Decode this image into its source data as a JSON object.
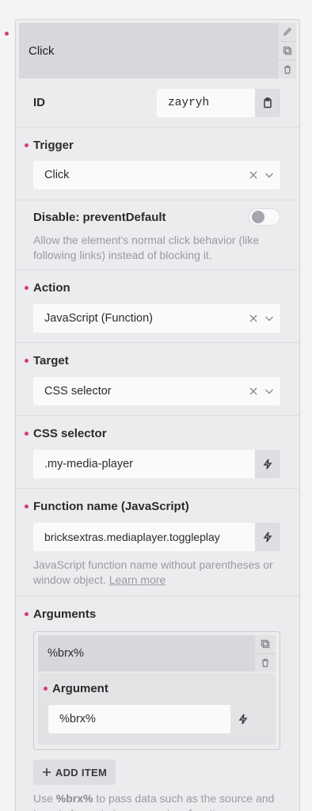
{
  "interaction": {
    "header_title": "Click",
    "header_actions": [
      "edit-icon",
      "copy-icon",
      "trash-icon"
    ]
  },
  "id_field": {
    "label": "ID",
    "value": "zayryh",
    "copy_icon": "clipboard-icon"
  },
  "trigger": {
    "label": "Trigger",
    "value": "Click"
  },
  "prevent_default": {
    "label": "Disable: preventDefault",
    "enabled": false,
    "description": "Allow the element's normal click behavior (like following links) instead of blocking it."
  },
  "action": {
    "label": "Action",
    "value": "JavaScript (Function)"
  },
  "target": {
    "label": "Target",
    "value": "CSS selector"
  },
  "css_selector": {
    "label": "CSS selector",
    "value": ".my-media-player"
  },
  "function_name": {
    "label": "Function name (JavaScript)",
    "value": "bricksextras.mediaplayer.toggleplay",
    "description": "JavaScript function name without parentheses or window object.",
    "learn_more": "Learn more"
  },
  "arguments": {
    "label": "Arguments",
    "item_title": "%brx%",
    "argument_label": "Argument",
    "argument_value": "%brx%",
    "add_item": "ADD ITEM"
  },
  "footer": {
    "prefix": "Use",
    "code": "%brx%",
    "suffix": "to pass data such as the source and target elements to your custom function"
  },
  "colors": {
    "accent_dot": "#d63a7f",
    "panel_bg": "#ececee",
    "header_bg": "#d8d8dc",
    "input_bg": "#fafafb"
  }
}
